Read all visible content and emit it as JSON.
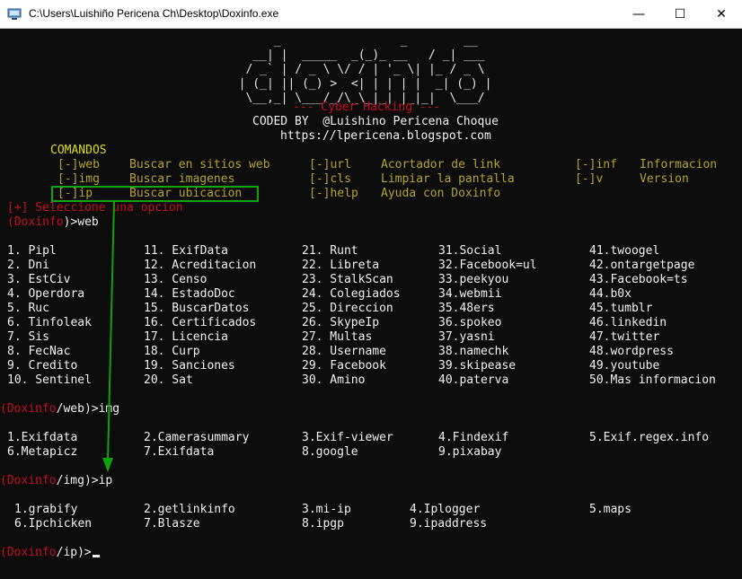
{
  "window": {
    "title": "C:\\Users\\Luishiño Pericena Ch\\Desktop\\Doxinfo.exe",
    "minimize": "—",
    "maximize": "☐",
    "close": "✕"
  },
  "banner": {
    "ascii": [
      "       _                 _        __",
      "    __| |  _____  _(_)_ __   / _| ___",
      "   / _` | / _ \\ \\/ / | '_ \\| |_ / _ \\",
      "  | (_| || (_) >  <| | | | |  _| (_) |",
      "   \\__,_| \\___/_/\\_\\_|_| |_|_|  \\___/"
    ],
    "subtitle": "--- Cyber Hacking ---",
    "coded_by": "CODED BY  @Luishino Pericena Choque",
    "url": "https://lpericena.blogspot.com"
  },
  "commands": {
    "header": "COMANDOS",
    "items": [
      {
        "cmd": "[-]web",
        "desc": "Buscar en sitios web"
      },
      {
        "cmd": "[-]img",
        "desc": "Buscar imagenes"
      },
      {
        "cmd": "[-]ip",
        "desc": "Buscar ubicacion"
      },
      {
        "cmd": "[-]url",
        "desc": "Acortador de link"
      },
      {
        "cmd": "[-]cls",
        "desc": "Limpiar la pantalla"
      },
      {
        "cmd": "[-]help",
        "desc": "Ayuda con Doxinfo"
      },
      {
        "cmd": "[-]inf",
        "desc": "Informacion"
      },
      {
        "cmd": "[-]v",
        "desc": "Version"
      }
    ]
  },
  "select_prompt": "[+] Seleccione una opcion",
  "prompts": [
    {
      "open": "(",
      "name": "Doxinfo",
      "path": "",
      "close": ")>",
      "input": "web"
    },
    {
      "open": "(",
      "name": "Doxinfo",
      "path": "/web",
      "close": ")>",
      "input": "img"
    },
    {
      "open": "(",
      "name": "Doxinfo",
      "path": "/img",
      "close": ")>",
      "input": "ip"
    },
    {
      "open": "(",
      "name": "Doxinfo",
      "path": "/ip",
      "close": ")>",
      "input": ""
    }
  ],
  "web_columns": [
    [
      "1. Pipl",
      "2. Dni",
      "3. EstCiv",
      "4. Operdora",
      "5. Ruc",
      "6. Tinfoleak",
      "7. Sis",
      "8. FecNac",
      "9. Credito",
      "10. Sentinel"
    ],
    [
      "11. ExifData",
      "12. Acreditacion",
      "13. Censo",
      "14. EstadoDoc",
      "15. BuscarDatos",
      "16. Certificados",
      "17. Licencia",
      "18. Curp",
      "19. Sanciones",
      "20. Sat"
    ],
    [
      "21. Runt",
      "22. Libreta",
      "23. StalkScan",
      "24. Colegiados",
      "25. Direccion",
      "26. SkypeIp",
      "27. Multas",
      "28. Username",
      "29. Facebook",
      "30. Amino"
    ],
    [
      "31.Social",
      "32.Facebook=ul",
      "33.peekyou",
      "34.webmii",
      "35.48ers",
      "36.spokeo",
      "37.yasni",
      "38.namechk",
      "39.skipease",
      "40.paterva"
    ],
    [
      "41.twoogel",
      "42.ontargetpage",
      "43.Facebook=ts",
      "44.b0x",
      "45.tumblr",
      "46.linkedin",
      "47.twitter",
      "48.wordpress",
      "49.youtube",
      "50.Mas informacion"
    ]
  ],
  "img_items": [
    "1.Exifdata",
    "2.Camerasummary",
    "3.Exif-viewer",
    "4.Findexif",
    "5.Exif.regex.info",
    "6.Metapicz",
    "7.Exifdata",
    "8.google",
    "9.pixabay"
  ],
  "ip_items": [
    "1.grabify",
    "2.getlinkinfo",
    "3.mi-ip",
    "4.Iplogger",
    "5.maps",
    "6.Ipchicken",
    "7.Blasze",
    "8.ipgp",
    "9.ipaddress"
  ]
}
